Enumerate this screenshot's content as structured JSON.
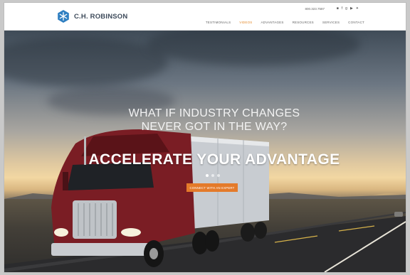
{
  "brand": {
    "name": "C.H. ROBINSON",
    "accent": "#e47a2a"
  },
  "header": {
    "phone": "800.323.7587",
    "social_icons": [
      "linkedin-icon",
      "facebook-icon",
      "googleplus-icon",
      "youtube-icon",
      "twitter-icon"
    ],
    "nav": [
      "TESTIMONIALS",
      "VIDEOS",
      "ADVANTAGES",
      "RESOURCES",
      "SERVICES",
      "CONTACT"
    ],
    "active_nav": "VIDEOS"
  },
  "hero": {
    "headline_line1": "WHAT IF INDUSTRY CHANGES",
    "headline_line2": "NEVER GOT IN THE WAY?",
    "tagline": "ACCELERATE YOUR ADVANTAGE",
    "cta_label": "CONNECT WITH AN EXPERT",
    "slide_count": 3,
    "active_slide": 1
  }
}
